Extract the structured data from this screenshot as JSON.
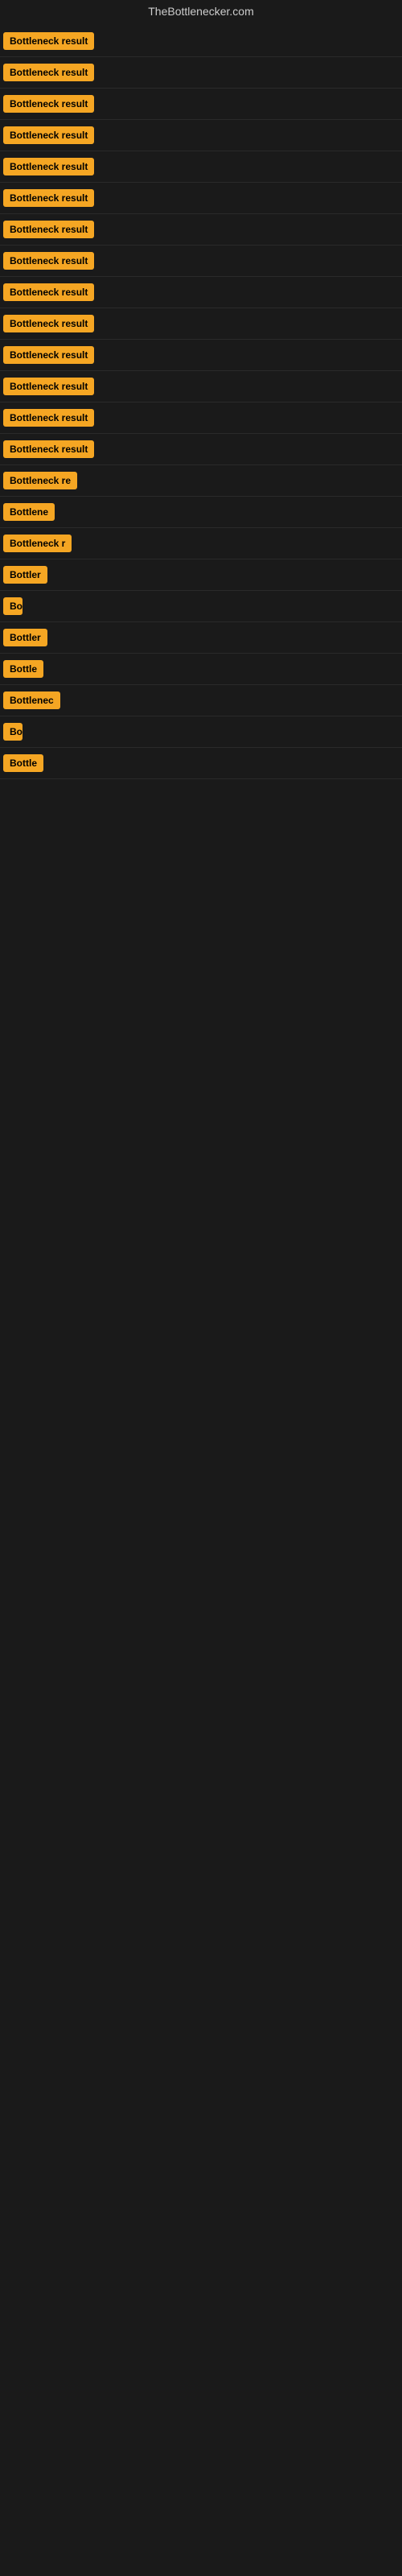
{
  "site": {
    "title": "TheBottlenecker.com"
  },
  "rows": [
    {
      "label": "Bottleneck result",
      "width": 120
    },
    {
      "label": "Bottleneck result",
      "width": 120
    },
    {
      "label": "Bottleneck result",
      "width": 120
    },
    {
      "label": "Bottleneck result",
      "width": 120
    },
    {
      "label": "Bottleneck result",
      "width": 120
    },
    {
      "label": "Bottleneck result",
      "width": 120
    },
    {
      "label": "Bottleneck result",
      "width": 120
    },
    {
      "label": "Bottleneck result",
      "width": 120
    },
    {
      "label": "Bottleneck result",
      "width": 120
    },
    {
      "label": "Bottleneck result",
      "width": 120
    },
    {
      "label": "Bottleneck result",
      "width": 120
    },
    {
      "label": "Bottleneck result",
      "width": 120
    },
    {
      "label": "Bottleneck result",
      "width": 120
    },
    {
      "label": "Bottleneck result",
      "width": 120
    },
    {
      "label": "Bottleneck re",
      "width": 100
    },
    {
      "label": "Bottlene",
      "width": 76
    },
    {
      "label": "Bottleneck r",
      "width": 92
    },
    {
      "label": "Bottler",
      "width": 64
    },
    {
      "label": "Bo",
      "width": 24
    },
    {
      "label": "Bottler",
      "width": 64
    },
    {
      "label": "Bottle",
      "width": 52
    },
    {
      "label": "Bottlenec",
      "width": 82
    },
    {
      "label": "Bo",
      "width": 24
    },
    {
      "label": "Bottle",
      "width": 52
    }
  ]
}
